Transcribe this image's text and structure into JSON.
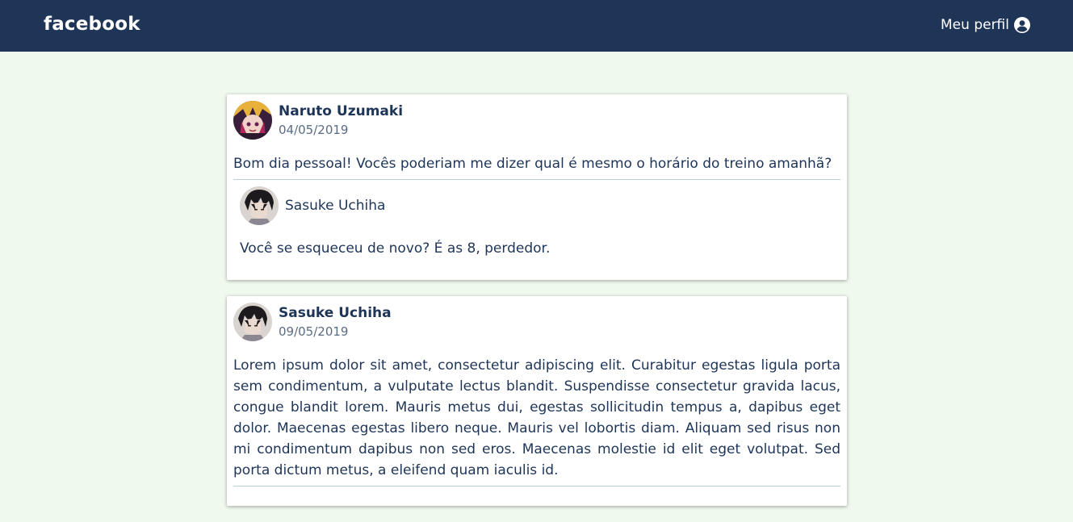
{
  "header": {
    "brand": "facebook",
    "profile_label": "Meu perfil",
    "profile_icon": "user-circle-icon",
    "background_color": "#1f3558"
  },
  "page": {
    "background_color": "#f0f9ee"
  },
  "posts": [
    {
      "author": "Naruto Uzumaki",
      "date": "04/05/2019",
      "text": "Bom dia pessoal! Vocês poderiam me dizer qual é mesmo o horário do treino amanhã?",
      "comments": [
        {
          "author": "Sasuke Uchiha",
          "text": "Você se esqueceu de novo? É as 8, perdedor."
        }
      ]
    },
    {
      "author": "Sasuke Uchiha",
      "date": "09/05/2019",
      "text": "Lorem ipsum dolor sit amet, consectetur adipiscing elit. Curabitur egestas ligula porta sem condimentum, a vulputate lectus blandit. Suspendisse consectetur gravida lacus, congue blandit lorem. Mauris metus dui, egestas sollicitudin tempus a, dapibus eget dolor. Maecenas egestas libero neque. Mauris vel lobortis diam. Aliquam sed risus non mi condimentum dapibus non sed eros. Maecenas molestie id elit eget volutpat. Sed porta dictum metus, a eleifend quam iaculis id."
    }
  ]
}
